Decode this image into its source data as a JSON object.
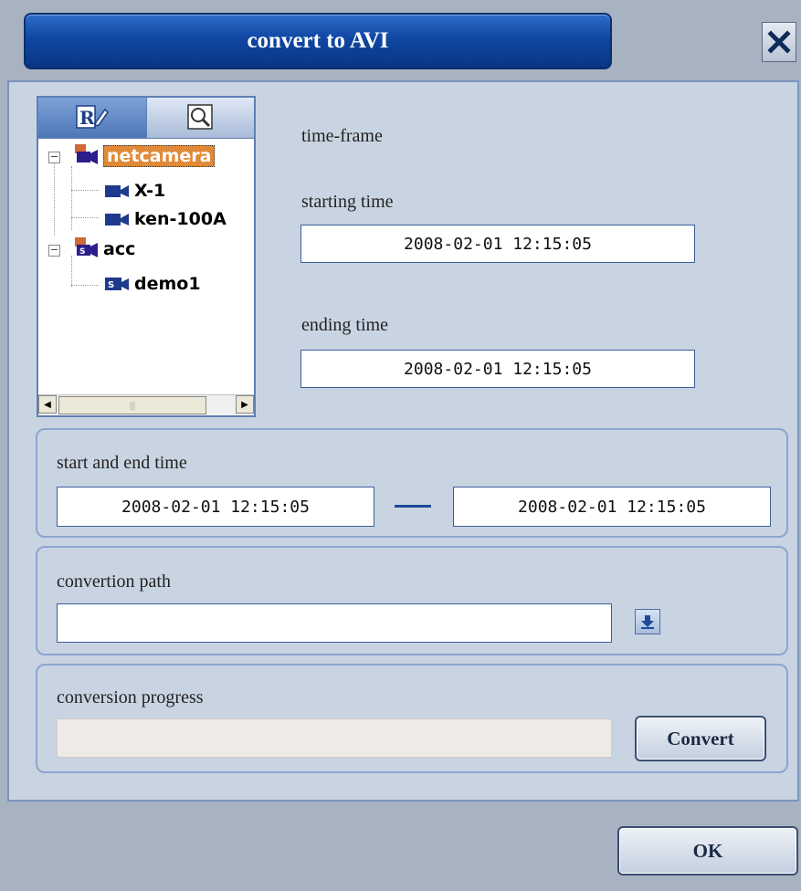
{
  "dialog": {
    "title": "convert to AVI"
  },
  "tree": {
    "tabs": [
      {
        "icon": "record-edit-icon",
        "active": true
      },
      {
        "icon": "search-icon",
        "active": false
      }
    ],
    "items": [
      {
        "label": "netcamera",
        "icon": "camera-group-icon",
        "level": 0,
        "selected": true,
        "expanded": true
      },
      {
        "label": "X-1",
        "icon": "camera-icon",
        "level": 1
      },
      {
        "label": "ken-100A",
        "icon": "camera-icon",
        "level": 1
      },
      {
        "label": "acc",
        "icon": "server-group-icon",
        "level": 0,
        "expanded": true
      },
      {
        "label": "demo1",
        "icon": "server-camera-icon",
        "level": 1
      }
    ]
  },
  "time_frame": {
    "heading": "time-frame",
    "starting_label": "starting time",
    "starting_value": "2008-02-01 12:15:05",
    "ending_label": "ending time",
    "ending_value": "2008-02-01 12:15:05"
  },
  "range": {
    "label": "start and end time",
    "start_value": "2008-02-01 12:15:05",
    "end_value": "2008-02-01 12:15:05"
  },
  "path": {
    "label": "convertion path",
    "value": ""
  },
  "progress": {
    "label": "conversion progress",
    "value": 0
  },
  "buttons": {
    "convert": "Convert",
    "ok": "OK"
  },
  "colors": {
    "title_bar": "#0f47a3",
    "selection": "#e08a38",
    "panel": "#c9d4e2"
  }
}
